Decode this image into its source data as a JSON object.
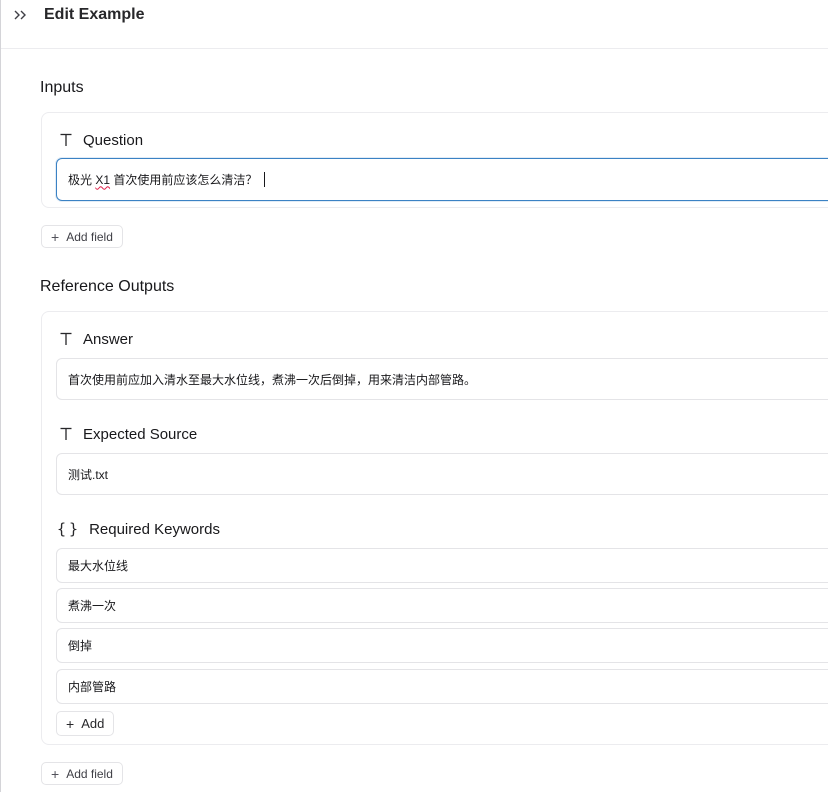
{
  "header": {
    "title": "Edit Example",
    "collapse_icon": "double-chevron-right-icon"
  },
  "inputs": {
    "section_title": "Inputs",
    "question": {
      "label": "Question",
      "value_prefix": "极光 ",
      "value_misspelled": "X1",
      "value_suffix": " 首次使用前应该怎么清洁？"
    },
    "add_field_label": "Add field"
  },
  "reference_outputs": {
    "section_title": "Reference Outputs",
    "answer": {
      "label": "Answer",
      "value": "首次使用前应加入清水至最大水位线，煮沸一次后倒掉，用来清洁内部管路。"
    },
    "expected_source": {
      "label": "Expected Source",
      "value": "测试.txt"
    },
    "required_keywords": {
      "label": "Required Keywords",
      "items": [
        "最大水位线",
        "煮沸一次",
        "倒掉",
        "内部管路"
      ],
      "add_label": "Add"
    },
    "add_field_label": "Add field"
  },
  "colors": {
    "focus_border": "#3b82c4",
    "card_border": "#ececef",
    "spellcheck": "#e11d48"
  }
}
